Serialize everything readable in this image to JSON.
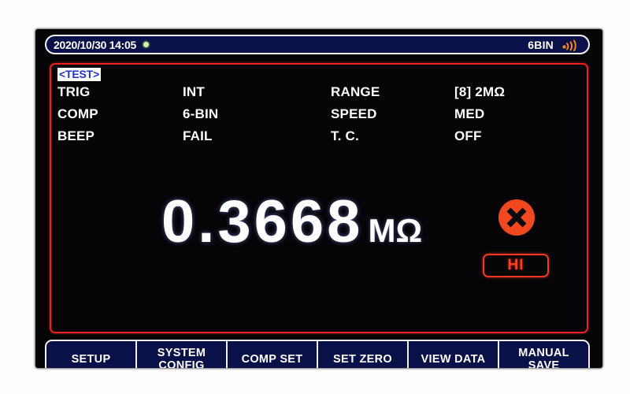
{
  "device": {
    "screen_label": "lcd-measurement-display"
  },
  "statusbar": {
    "datetime": "2020/10/30  14:05",
    "rec_indicator": "recording-dot",
    "mode": "6BIN",
    "signal_icon": "wireless-signal-icon"
  },
  "measurement": {
    "section_tag": "<TEST>",
    "params": [
      {
        "label": "TRIG",
        "value": "INT"
      },
      {
        "label": "COMP",
        "value": "6-BIN"
      },
      {
        "label": "BEEP",
        "value": "FAIL"
      }
    ],
    "params_right": [
      {
        "label": "RANGE",
        "value": "[8] 2MΩ"
      },
      {
        "label": "SPEED",
        "value": "MED"
      },
      {
        "label": "T. C.",
        "value": "OFF"
      }
    ],
    "reading": {
      "value": "0.3668",
      "unit": "MΩ"
    },
    "judgement": {
      "status_icon": "fail-cross-icon",
      "bin_label": "HI"
    }
  },
  "softkeys": [
    {
      "label": "SETUP"
    },
    {
      "label": "SYSTEM\nCONFIG"
    },
    {
      "label": "COMP SET"
    },
    {
      "label": "SET ZERO"
    },
    {
      "label": "VIEW DATA"
    },
    {
      "label": "MANUAL\nSAVE"
    }
  ],
  "colors": {
    "frame_red": "#ef2020",
    "bar_navy": "#0a1048",
    "fail_orange": "#f2441f",
    "tag_blue": "#2233cc",
    "screen_black": "#050508"
  }
}
